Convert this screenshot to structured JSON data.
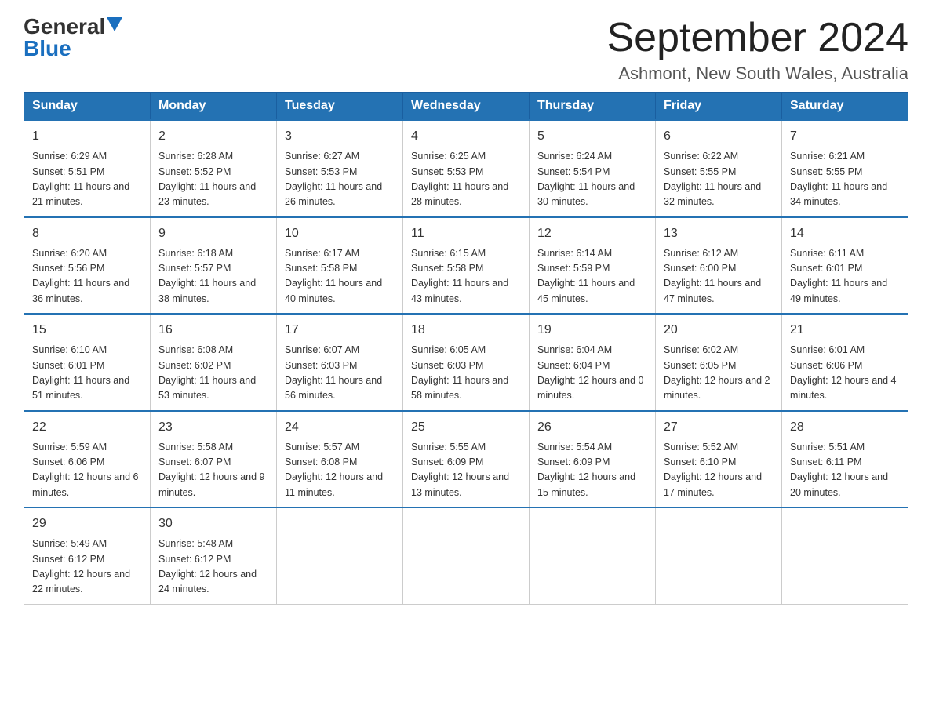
{
  "logo": {
    "general": "General",
    "blue": "Blue"
  },
  "header": {
    "title": "September 2024",
    "subtitle": "Ashmont, New South Wales, Australia"
  },
  "days_of_week": [
    "Sunday",
    "Monday",
    "Tuesday",
    "Wednesday",
    "Thursday",
    "Friday",
    "Saturday"
  ],
  "weeks": [
    [
      {
        "day": "1",
        "sunrise": "6:29 AM",
        "sunset": "5:51 PM",
        "daylight": "11 hours and 21 minutes."
      },
      {
        "day": "2",
        "sunrise": "6:28 AM",
        "sunset": "5:52 PM",
        "daylight": "11 hours and 23 minutes."
      },
      {
        "day": "3",
        "sunrise": "6:27 AM",
        "sunset": "5:53 PM",
        "daylight": "11 hours and 26 minutes."
      },
      {
        "day": "4",
        "sunrise": "6:25 AM",
        "sunset": "5:53 PM",
        "daylight": "11 hours and 28 minutes."
      },
      {
        "day": "5",
        "sunrise": "6:24 AM",
        "sunset": "5:54 PM",
        "daylight": "11 hours and 30 minutes."
      },
      {
        "day": "6",
        "sunrise": "6:22 AM",
        "sunset": "5:55 PM",
        "daylight": "11 hours and 32 minutes."
      },
      {
        "day": "7",
        "sunrise": "6:21 AM",
        "sunset": "5:55 PM",
        "daylight": "11 hours and 34 minutes."
      }
    ],
    [
      {
        "day": "8",
        "sunrise": "6:20 AM",
        "sunset": "5:56 PM",
        "daylight": "11 hours and 36 minutes."
      },
      {
        "day": "9",
        "sunrise": "6:18 AM",
        "sunset": "5:57 PM",
        "daylight": "11 hours and 38 minutes."
      },
      {
        "day": "10",
        "sunrise": "6:17 AM",
        "sunset": "5:58 PM",
        "daylight": "11 hours and 40 minutes."
      },
      {
        "day": "11",
        "sunrise": "6:15 AM",
        "sunset": "5:58 PM",
        "daylight": "11 hours and 43 minutes."
      },
      {
        "day": "12",
        "sunrise": "6:14 AM",
        "sunset": "5:59 PM",
        "daylight": "11 hours and 45 minutes."
      },
      {
        "day": "13",
        "sunrise": "6:12 AM",
        "sunset": "6:00 PM",
        "daylight": "11 hours and 47 minutes."
      },
      {
        "day": "14",
        "sunrise": "6:11 AM",
        "sunset": "6:01 PM",
        "daylight": "11 hours and 49 minutes."
      }
    ],
    [
      {
        "day": "15",
        "sunrise": "6:10 AM",
        "sunset": "6:01 PM",
        "daylight": "11 hours and 51 minutes."
      },
      {
        "day": "16",
        "sunrise": "6:08 AM",
        "sunset": "6:02 PM",
        "daylight": "11 hours and 53 minutes."
      },
      {
        "day": "17",
        "sunrise": "6:07 AM",
        "sunset": "6:03 PM",
        "daylight": "11 hours and 56 minutes."
      },
      {
        "day": "18",
        "sunrise": "6:05 AM",
        "sunset": "6:03 PM",
        "daylight": "11 hours and 58 minutes."
      },
      {
        "day": "19",
        "sunrise": "6:04 AM",
        "sunset": "6:04 PM",
        "daylight": "12 hours and 0 minutes."
      },
      {
        "day": "20",
        "sunrise": "6:02 AM",
        "sunset": "6:05 PM",
        "daylight": "12 hours and 2 minutes."
      },
      {
        "day": "21",
        "sunrise": "6:01 AM",
        "sunset": "6:06 PM",
        "daylight": "12 hours and 4 minutes."
      }
    ],
    [
      {
        "day": "22",
        "sunrise": "5:59 AM",
        "sunset": "6:06 PM",
        "daylight": "12 hours and 6 minutes."
      },
      {
        "day": "23",
        "sunrise": "5:58 AM",
        "sunset": "6:07 PM",
        "daylight": "12 hours and 9 minutes."
      },
      {
        "day": "24",
        "sunrise": "5:57 AM",
        "sunset": "6:08 PM",
        "daylight": "12 hours and 11 minutes."
      },
      {
        "day": "25",
        "sunrise": "5:55 AM",
        "sunset": "6:09 PM",
        "daylight": "12 hours and 13 minutes."
      },
      {
        "day": "26",
        "sunrise": "5:54 AM",
        "sunset": "6:09 PM",
        "daylight": "12 hours and 15 minutes."
      },
      {
        "day": "27",
        "sunrise": "5:52 AM",
        "sunset": "6:10 PM",
        "daylight": "12 hours and 17 minutes."
      },
      {
        "day": "28",
        "sunrise": "5:51 AM",
        "sunset": "6:11 PM",
        "daylight": "12 hours and 20 minutes."
      }
    ],
    [
      {
        "day": "29",
        "sunrise": "5:49 AM",
        "sunset": "6:12 PM",
        "daylight": "12 hours and 22 minutes."
      },
      {
        "day": "30",
        "sunrise": "5:48 AM",
        "sunset": "6:12 PM",
        "daylight": "12 hours and 24 minutes."
      },
      null,
      null,
      null,
      null,
      null
    ]
  ]
}
